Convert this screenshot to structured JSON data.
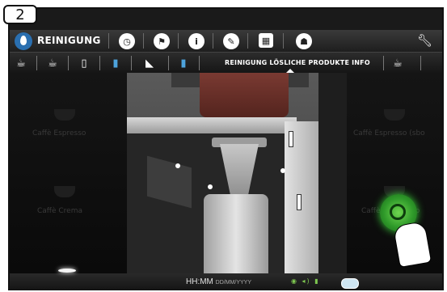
{
  "step_badge": "2",
  "header": {
    "title": "REINIGUNG",
    "icons": [
      "clock-icon",
      "flag-icon",
      "info-icon",
      "pencil-icon",
      "calendar-icon",
      "user-icon"
    ],
    "settings_icon": "wrench-icon"
  },
  "tabs": {
    "items": [
      "rinse-cup-icon",
      "cup-icon",
      "milk-carton-icon",
      "glass-icon",
      "milk-pour-icon",
      "water-glass-icon"
    ],
    "active_label": "REINIGUNG LÖSLICHE PRODUKTE INFO",
    "extra_icon": "sparkle-cup-icon"
  },
  "background_products": {
    "top_left": "Caffè Espresso",
    "top_right": "Caffè Espresso (sbo",
    "bottom_left": "Caffè Crema",
    "bottom_right": "Caffè Macchiato"
  },
  "statusbar": {
    "time": "HH:MM",
    "date": "DD/MM/YYYY"
  },
  "colors": {
    "accent_blue": "#2a6fb0",
    "confirm_green": "#3ad13a"
  }
}
